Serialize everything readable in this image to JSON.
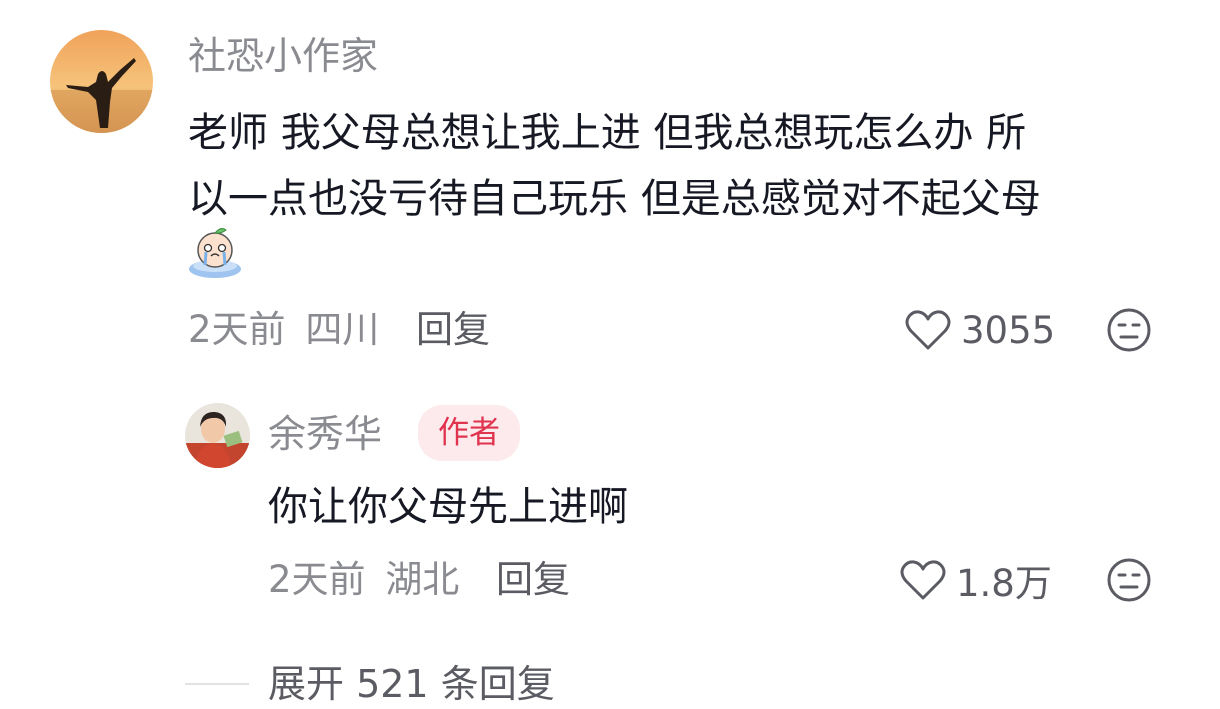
{
  "comment": {
    "author": "社恐小作家",
    "text_line1": "老师 我父母总想让我上进 但我总想玩怎么办 所",
    "text_line2": "以一点也没亏待自己玩乐 但是总感觉对不起父母",
    "emoji_icon": "crying-peach-emoji-icon",
    "time": "2天前",
    "location": "四川",
    "reply_label": "回复",
    "likes": "3055",
    "dislike_icon": "neutral-face-icon"
  },
  "reply": {
    "author": "余秀华",
    "badge": "作者",
    "text": "你让你父母先上进啊",
    "time": "2天前",
    "location": "湖北",
    "reply_label": "回复",
    "likes": "1.8万",
    "dislike_icon": "neutral-face-icon"
  },
  "expand": {
    "label": "展开 521 条回复"
  },
  "colors": {
    "secondary_text": "#8a8b91",
    "primary_text": "#161823",
    "author_badge_bg": "#fdeaec",
    "author_badge_text": "#e0334e"
  }
}
